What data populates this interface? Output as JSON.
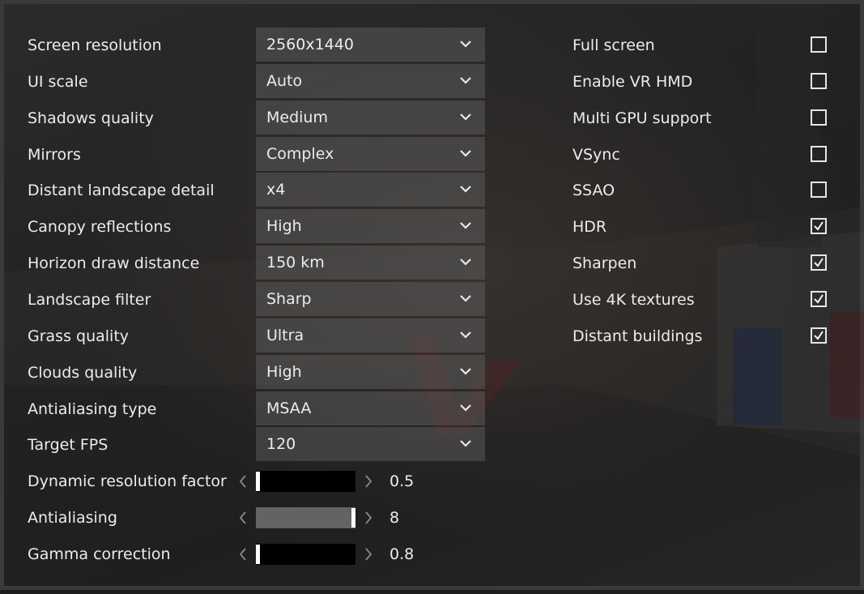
{
  "dropdowns": [
    {
      "label": "Screen resolution",
      "value": "2560x1440"
    },
    {
      "label": "UI scale",
      "value": "Auto"
    },
    {
      "label": "Shadows quality",
      "value": "Medium"
    },
    {
      "label": "Mirrors",
      "value": "Complex"
    },
    {
      "label": "Distant landscape detail",
      "value": "x4"
    },
    {
      "label": "Canopy reflections",
      "value": "High"
    },
    {
      "label": "Horizon draw distance",
      "value": "150 km"
    },
    {
      "label": "Landscape filter",
      "value": "Sharp"
    },
    {
      "label": "Grass quality",
      "value": "Ultra"
    },
    {
      "label": "Clouds quality",
      "value": "High"
    },
    {
      "label": "Antialiasing type",
      "value": "MSAA"
    },
    {
      "label": "Target FPS",
      "value": "120"
    }
  ],
  "sliders": [
    {
      "label": "Dynamic resolution factor",
      "value": "0.5",
      "fill_fraction": 0.0
    },
    {
      "label": "Antialiasing",
      "value": "8",
      "fill_fraction": 1.0
    },
    {
      "label": "Gamma correction",
      "value": "0.8",
      "fill_fraction": 0.0
    }
  ],
  "checkboxes": [
    {
      "label": "Full screen",
      "checked": false
    },
    {
      "label": "Enable VR HMD",
      "checked": false
    },
    {
      "label": "Multi GPU support",
      "checked": false
    },
    {
      "label": "VSync",
      "checked": false
    },
    {
      "label": "SSAO",
      "checked": false
    },
    {
      "label": "HDR",
      "checked": true
    },
    {
      "label": "Sharpen",
      "checked": true
    },
    {
      "label": "Use 4K textures",
      "checked": true
    },
    {
      "label": "Distant buildings",
      "checked": true
    }
  ],
  "icons": {
    "dropdown": "chevron-down-icon",
    "check": "checkmark-icon",
    "left": "chevron-left-icon",
    "right": "chevron-right-icon"
  },
  "colors": {
    "text": "#ececec",
    "dropdown_bg": "#5a5a5a",
    "track": "#000000",
    "track_fill": "#636363",
    "thumb": "#ffffff"
  }
}
